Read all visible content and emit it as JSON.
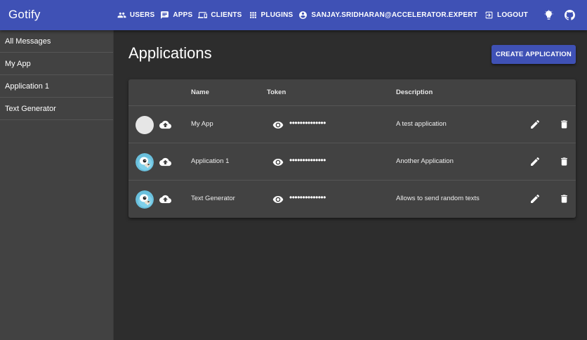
{
  "app": {
    "brand": "Gotify"
  },
  "nav": {
    "users": "USERS",
    "apps": "APPS",
    "clients": "CLIENTS",
    "plugins": "PLUGINS",
    "user": "SANJAY.SRIDHARAN@ACCELERATOR.EXPERT",
    "logout": "LOGOUT",
    "theme_icon": "lightbulb-icon",
    "github_icon": "github-icon"
  },
  "sidebar": {
    "items": [
      {
        "label": "All Messages"
      },
      {
        "label": "My App"
      },
      {
        "label": "Application 1"
      },
      {
        "label": "Text Generator"
      }
    ]
  },
  "main": {
    "title": "Applications",
    "create_label": "CREATE APPLICATION"
  },
  "table": {
    "columns": {
      "name": "Name",
      "token": "Token",
      "description": "Description"
    },
    "rows": [
      {
        "name": "My App",
        "token": "••••••••••••••",
        "description": "A test application",
        "image": "blank-avatar"
      },
      {
        "name": "Application 1",
        "token": "••••••••••••••",
        "description": "Another Application",
        "image": "gopher-avatar"
      },
      {
        "name": "Text Generator",
        "token": "••••••••••••••",
        "description": "Allows to send random texts",
        "image": "gopher-avatar"
      }
    ]
  },
  "colors": {
    "primary": "#3f51b5",
    "background": "#2d2d2d",
    "surface": "#424242"
  }
}
